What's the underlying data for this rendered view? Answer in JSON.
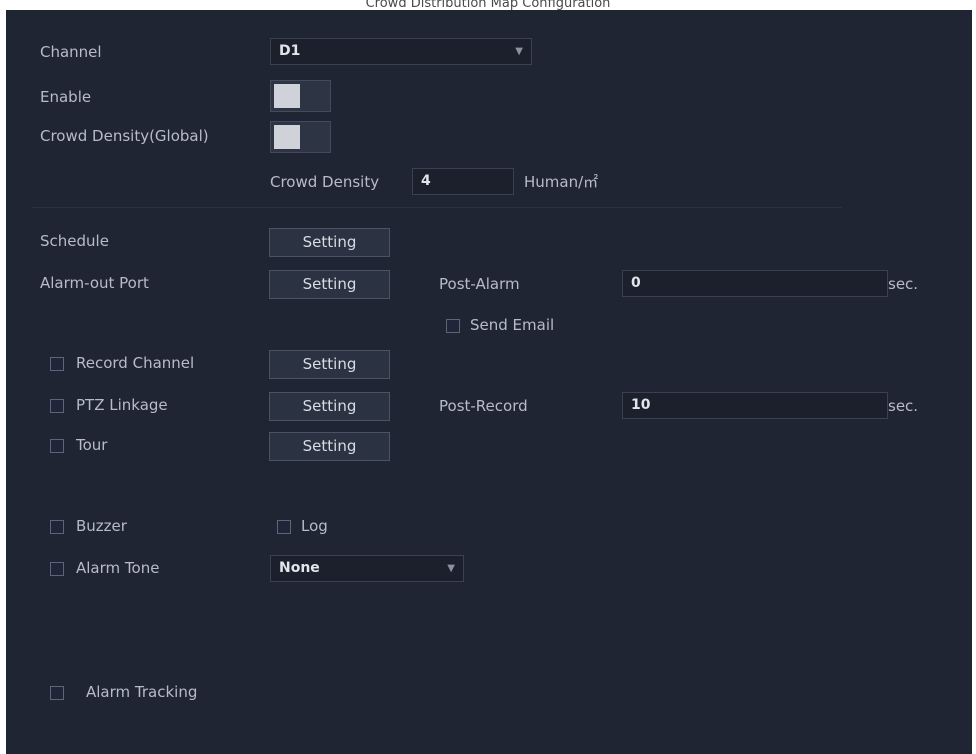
{
  "header": {
    "title": "Crowd Distribution Map Configuration"
  },
  "form": {
    "channel_label": "Channel",
    "channel_value": "D1",
    "enable_label": "Enable",
    "crowd_density_global_label": "Crowd Density(Global)",
    "crowd_density_label": "Crowd Density",
    "crowd_density_value": "4",
    "crowd_density_unit": "Human/㎡",
    "schedule_label": "Schedule",
    "alarm_out_label": "Alarm-out Port",
    "post_alarm_label": "Post-Alarm",
    "post_alarm_value": "0",
    "post_alarm_unit": "sec.",
    "send_email_label": "Send Email",
    "record_channel_label": "Record Channel",
    "ptz_label": "PTZ Linkage",
    "post_record_label": "Post-Record",
    "post_record_value": "10",
    "post_record_unit": "sec.",
    "tour_label": "Tour",
    "buzzer_label": "Buzzer",
    "log_label": "Log",
    "alarm_tone_label": "Alarm Tone",
    "alarm_tone_value": "None",
    "alarm_tracking_label": "Alarm Tracking",
    "setting_label": "Setting"
  },
  "colors": {
    "panel_bg": "#1f2533",
    "text": "#b7bcc6"
  }
}
